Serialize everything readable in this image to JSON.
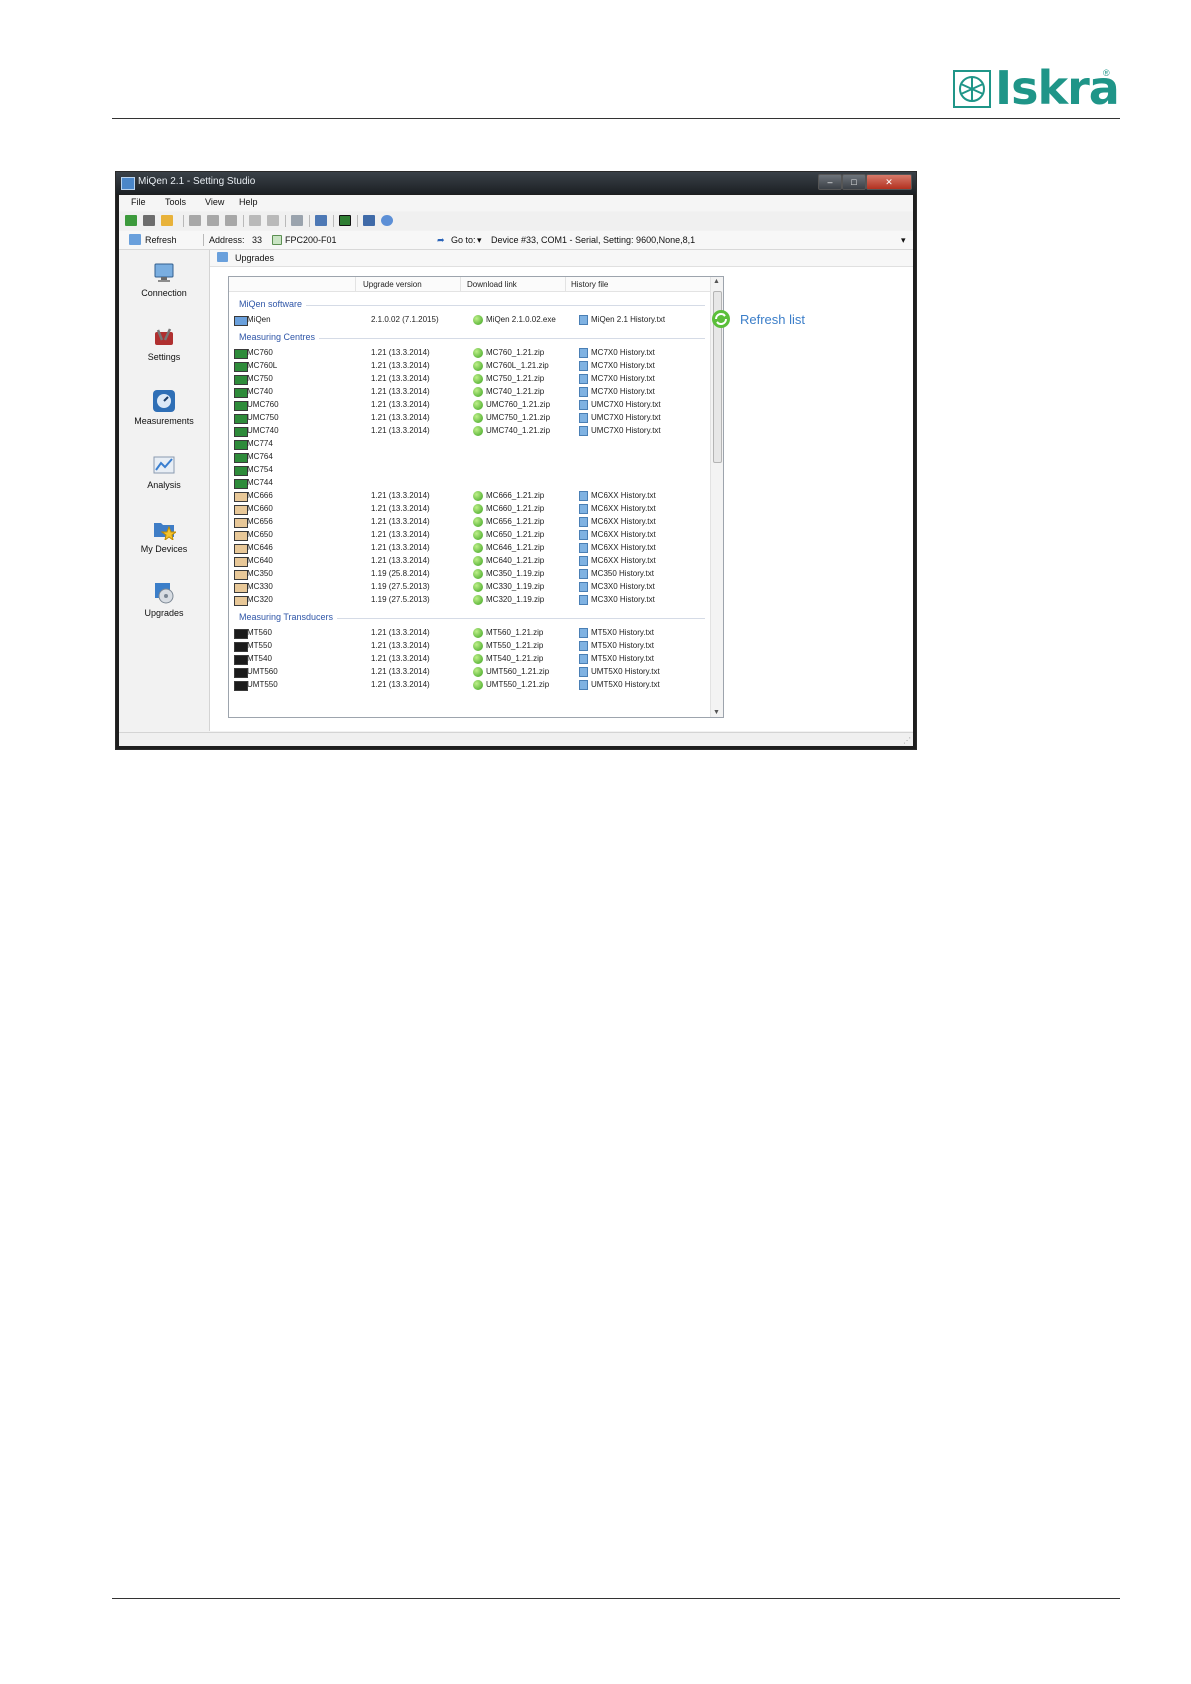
{
  "brand": {
    "name": "Iskra",
    "registered": "®",
    "color": "#1f9588"
  },
  "window": {
    "title": "MiQen 2.1 - Setting Studio",
    "controls": [
      "minimize",
      "maximize",
      "close"
    ]
  },
  "menu": [
    "File",
    "Tools",
    "View",
    "Help"
  ],
  "toolbar_icons": [
    "new-icon",
    "print-icon",
    "open-icon",
    "cut-icon",
    "save-icon",
    "copy-icon",
    "printer-icon",
    "preview-icon",
    "book-icon",
    "tag-icon",
    "device-icon",
    "pen-icon",
    "network-icon"
  ],
  "address_bar": {
    "refresh_label": "Refresh",
    "address_label": "Address:",
    "address_value": "33",
    "device_label": "FPC200-F01",
    "goto_label": "Go to:",
    "goto_value": "Device #33, COM1 - Serial, Setting: 9600,None,8,1"
  },
  "sidebar": [
    {
      "label": "Connection",
      "icon": "computer-icon"
    },
    {
      "label": "Settings",
      "icon": "tools-icon"
    },
    {
      "label": "Measurements",
      "icon": "gauge-icon"
    },
    {
      "label": "Analysis",
      "icon": "chart-icon"
    },
    {
      "label": "My Devices",
      "icon": "folder-star-icon"
    },
    {
      "label": "Upgrades",
      "icon": "disk-icon"
    }
  ],
  "pane_title": "Upgrades",
  "columns": [
    "Upgrade version",
    "Download link",
    "History file"
  ],
  "groups": {
    "software": "MiQen software",
    "centres": "Measuring Centres",
    "transducers": "Measuring Transducers"
  },
  "rows_software": [
    {
      "name": "MiQen",
      "version": "2.1.0.02 (7.1.2015)",
      "download": "MiQen 2.1.0.02.exe",
      "history": "MiQen 2.1 History.txt"
    }
  ],
  "rows_centres": [
    {
      "name": "MC760",
      "version": "1.21 (13.3.2014)",
      "download": "MC760_1.21.zip",
      "history": "MC7X0 History.txt"
    },
    {
      "name": "MC760L",
      "version": "1.21 (13.3.2014)",
      "download": "MC760L_1.21.zip",
      "history": "MC7X0 History.txt"
    },
    {
      "name": "MC750",
      "version": "1.21 (13.3.2014)",
      "download": "MC750_1.21.zip",
      "history": "MC7X0 History.txt"
    },
    {
      "name": "MC740",
      "version": "1.21 (13.3.2014)",
      "download": "MC740_1.21.zip",
      "history": "MC7X0 History.txt"
    },
    {
      "name": "UMC760",
      "version": "1.21 (13.3.2014)",
      "download": "UMC760_1.21.zip",
      "history": "UMC7X0 History.txt"
    },
    {
      "name": "UMC750",
      "version": "1.21 (13.3.2014)",
      "download": "UMC750_1.21.zip",
      "history": "UMC7X0 History.txt"
    },
    {
      "name": "UMC740",
      "version": "1.21 (13.3.2014)",
      "download": "UMC740_1.21.zip",
      "history": "UMC7X0 History.txt"
    },
    {
      "name": "MC774",
      "version": "",
      "download": "",
      "history": ""
    },
    {
      "name": "MC764",
      "version": "",
      "download": "",
      "history": ""
    },
    {
      "name": "MC754",
      "version": "",
      "download": "",
      "history": ""
    },
    {
      "name": "MC744",
      "version": "",
      "download": "",
      "history": ""
    },
    {
      "name": "MC666",
      "version": "1.21 (13.3.2014)",
      "download": "MC666_1.21.zip",
      "history": "MC6XX History.txt"
    },
    {
      "name": "MC660",
      "version": "1.21 (13.3.2014)",
      "download": "MC660_1.21.zip",
      "history": "MC6XX History.txt"
    },
    {
      "name": "MC656",
      "version": "1.21 (13.3.2014)",
      "download": "MC656_1.21.zip",
      "history": "MC6XX History.txt"
    },
    {
      "name": "MC650",
      "version": "1.21 (13.3.2014)",
      "download": "MC650_1.21.zip",
      "history": "MC6XX History.txt"
    },
    {
      "name": "MC646",
      "version": "1.21 (13.3.2014)",
      "download": "MC646_1.21.zip",
      "history": "MC6XX History.txt"
    },
    {
      "name": "MC640",
      "version": "1.21 (13.3.2014)",
      "download": "MC640_1.21.zip",
      "history": "MC6XX History.txt"
    },
    {
      "name": "MC350",
      "version": "1.19 (25.8.2014)",
      "download": "MC350_1.19.zip",
      "history": "MC350 History.txt"
    },
    {
      "name": "MC330",
      "version": "1.19 (27.5.2013)",
      "download": "MC330_1.19.zip",
      "history": "MC3X0 History.txt"
    },
    {
      "name": "MC320",
      "version": "1.19 (27.5.2013)",
      "download": "MC320_1.19.zip",
      "history": "MC3X0 History.txt"
    }
  ],
  "rows_transducers": [
    {
      "name": "MT560",
      "version": "1.21 (13.3.2014)",
      "download": "MT560_1.21.zip",
      "history": "MT5X0 History.txt"
    },
    {
      "name": "MT550",
      "version": "1.21 (13.3.2014)",
      "download": "MT550_1.21.zip",
      "history": "MT5X0 History.txt"
    },
    {
      "name": "MT540",
      "version": "1.21 (13.3.2014)",
      "download": "MT540_1.21.zip",
      "history": "MT5X0 History.txt"
    },
    {
      "name": "UMT560",
      "version": "1.21 (13.3.2014)",
      "download": "UMT560_1.21.zip",
      "history": "UMT5X0 History.txt"
    },
    {
      "name": "UMT550",
      "version": "1.21 (13.3.2014)",
      "download": "UMT550_1.21.zip",
      "history": "UMT5X0 History.txt"
    }
  ],
  "refresh_list_label": "Refresh list"
}
